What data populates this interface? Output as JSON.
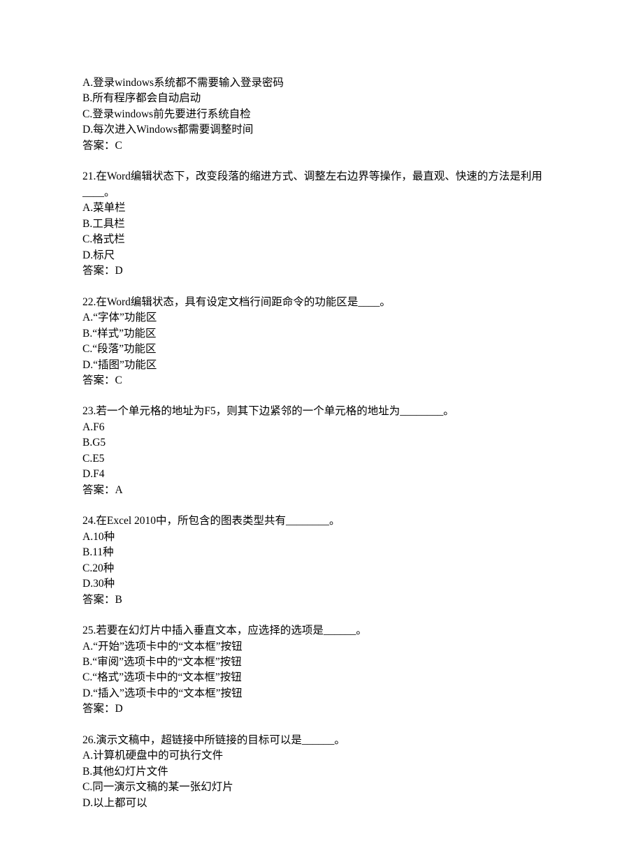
{
  "lead": {
    "optA": "A.登录windows系统都不需要输入登录密码",
    "optB": "B.所有程序都会自动启动",
    "optC": "C.登录windows前先要进行系统自检",
    "optD": "D.每次进入Windows都需要调整时间",
    "answer": "答案：C"
  },
  "questions": [
    {
      "stem": "21.在Word编辑状态下，改变段落的缩进方式、调整左右边界等操作，最直观、快速的方法是利用____。",
      "optA": "A.菜单栏",
      "optB": "B.工具栏",
      "optC": "C.格式栏",
      "optD": "D.标尺",
      "answer": "答案：D"
    },
    {
      "stem": "22.在Word编辑状态，具有设定文档行间距命令的功能区是____。",
      "optA": "A.“字体”功能区",
      "optB": "B.“样式”功能区",
      "optC": "C.“段落”功能区",
      "optD": "D.“插图”功能区",
      "answer": "答案：C"
    },
    {
      "stem": "23.若一个单元格的地址为F5，则其下边紧邻的一个单元格的地址为________。",
      "optA": "A.F6",
      "optB": "B.G5",
      "optC": "C.E5",
      "optD": "D.F4",
      "answer": "答案：A"
    },
    {
      "stem": "24.在Excel 2010中，所包含的图表类型共有________。",
      "optA": "A.10种",
      "optB": "B.11种",
      "optC": "C.20种",
      "optD": "D.30种",
      "answer": "答案：B"
    },
    {
      "stem": "25.若要在幻灯片中插入垂直文本，应选择的选项是______。",
      "optA": "A.“开始”选项卡中的“文本框”按钮",
      "optB": "B.“审阅”选项卡中的“文本框”按钮",
      "optC": "C.“格式”选项卡中的“文本框”按钮",
      "optD": "D.“插入”选项卡中的“文本框”按钮",
      "answer": "答案：D"
    },
    {
      "stem": "26.演示文稿中，超链接中所链接的目标可以是______。",
      "optA": "A.计算机硬盘中的可执行文件",
      "optB": "B.其他幻灯片文件",
      "optC": "C.同一演示文稿的某一张幻灯片",
      "optD": "D.以上都可以",
      "answer": ""
    }
  ]
}
